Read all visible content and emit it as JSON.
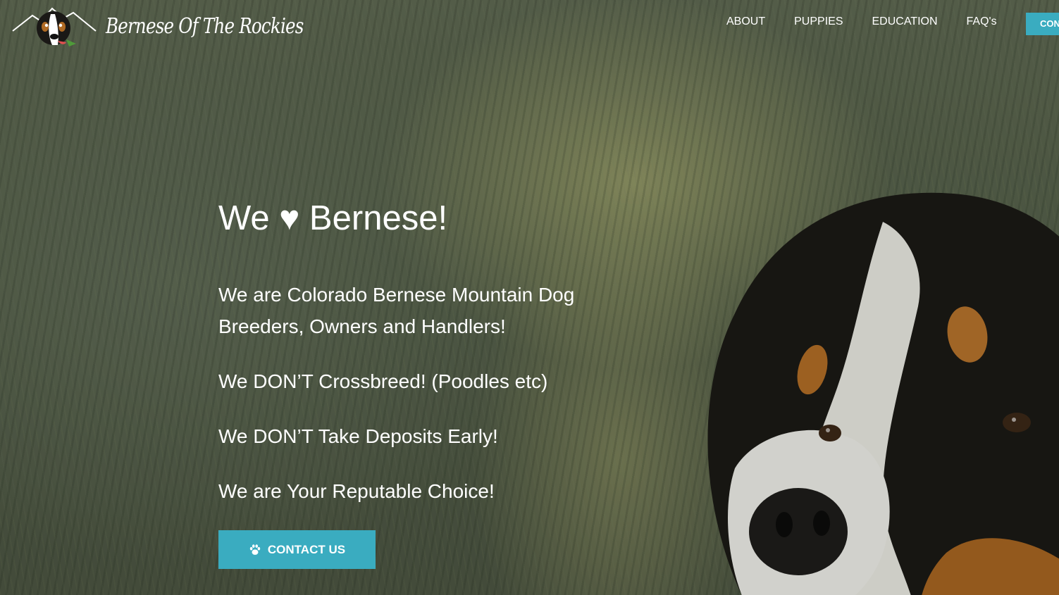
{
  "brand": {
    "name": "Bernese Of The Rockies",
    "logo_icon": "dog-mountain-logo"
  },
  "nav": {
    "items": [
      {
        "label": "ABOUT"
      },
      {
        "label": "PUPPIES"
      },
      {
        "label": "EDUCATION"
      },
      {
        "label": "FAQ's"
      }
    ],
    "cta_label": "CON"
  },
  "hero": {
    "headline": "We ♥ Bernese!",
    "paragraphs": [
      "We are Colorado Bernese Mountain Dog Breeders, Owners and Handlers!",
      "We DON’T Crossbreed! (Poodles etc)",
      "We DON’T Take Deposits Early!",
      "We are Your Reputable Choice!"
    ],
    "button_label": "CONTACT US",
    "button_icon": "paw-icon"
  },
  "colors": {
    "accent": "#3aacc0",
    "text": "#ffffff"
  }
}
